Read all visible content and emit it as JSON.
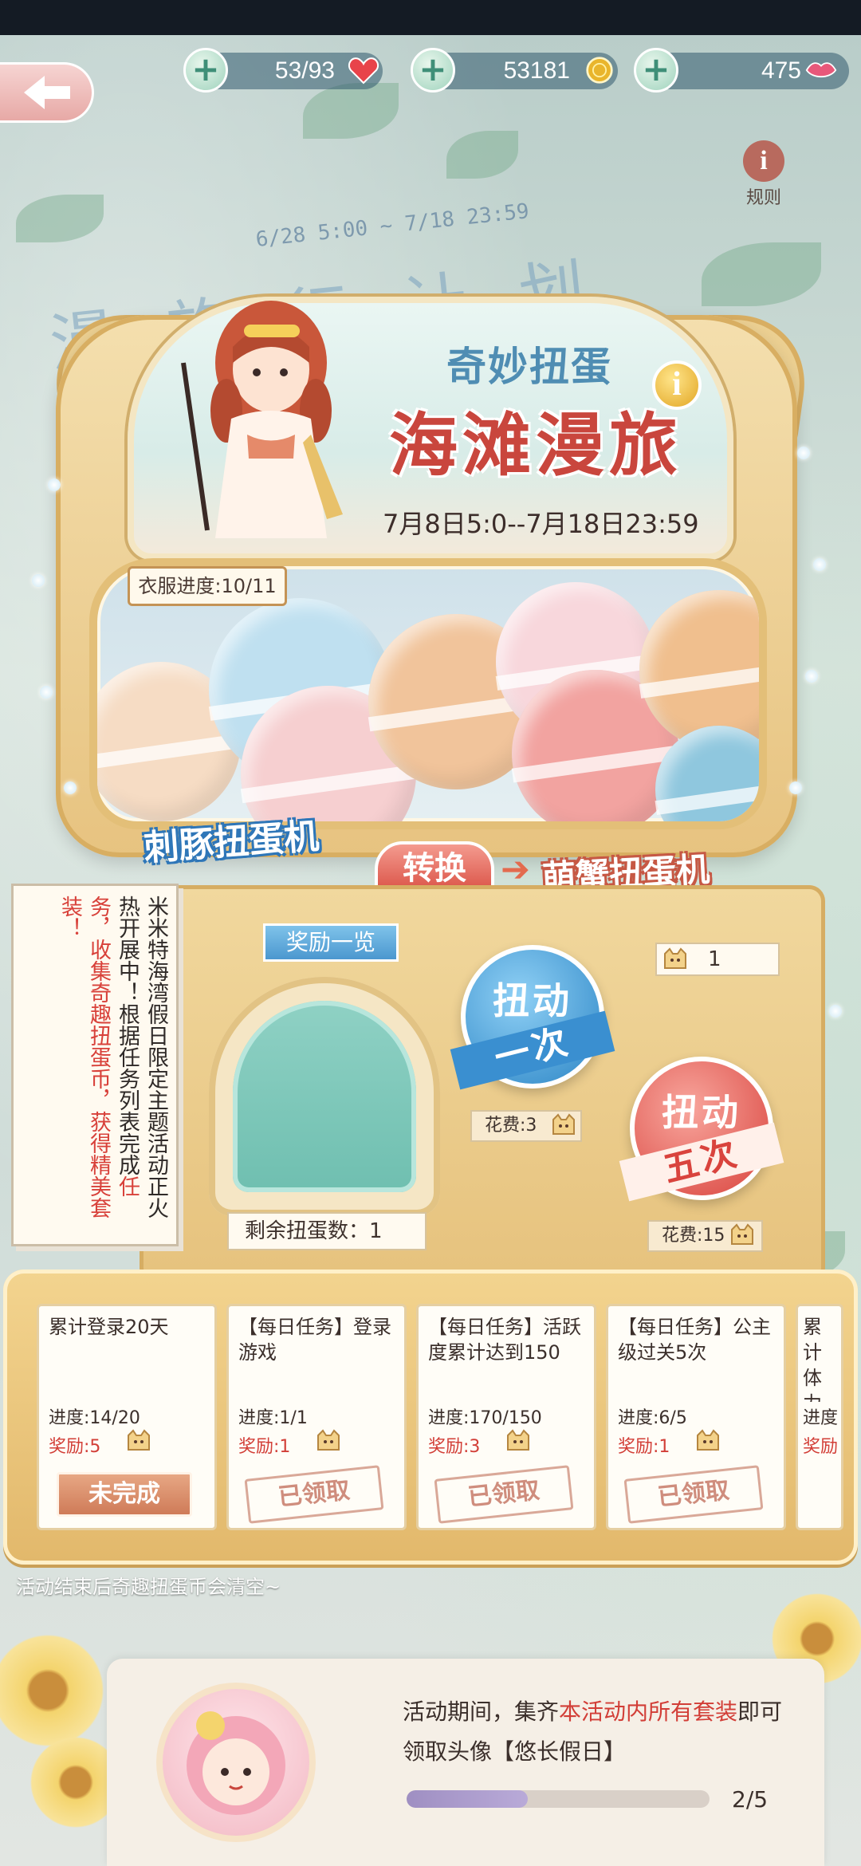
{
  "resources": {
    "stamina": "53/93",
    "gold": "53181",
    "diamonds": "475"
  },
  "rules_label": "规则",
  "event": {
    "dates_bg": "6/28  5:00 ~ 7/18  23:59",
    "bg_title": "漫 旅 行 计 划",
    "subtitle": "奇妙扭蛋",
    "title": "海滩漫旅",
    "date_range": "7月8日5:0--7月18日23:59",
    "outfit_progress": "衣服进度:10/11"
  },
  "machine": {
    "left_mode": "刺豚扭蛋机",
    "switch_label": "转换",
    "right_mode": "萌蟹扭蛋机",
    "reward_list_label": "奖励一览",
    "remaining_label": "剩余扭蛋数：1",
    "coin_count": "1",
    "spin_one": {
      "line1": "扭动",
      "line2": "一次",
      "cost": "花费:3"
    },
    "spin_five": {
      "line1": "扭动",
      "line2": "五次",
      "cost": "花费:15"
    }
  },
  "notice": {
    "text1": "米米特海湾假日限定主题活动正火热开展中！根据任务列表完成",
    "text2": "任务，收集奇趣扭蛋币，获得精美套装！"
  },
  "tasks": [
    {
      "title": "累计登录20天",
      "progress": "进度:14/20",
      "reward": "奖励:5",
      "status": "未完成",
      "state": "undone"
    },
    {
      "title": "【每日任务】登录游戏",
      "progress": "进度:1/1",
      "reward": "奖励:1",
      "status": "已领取",
      "state": "claimed"
    },
    {
      "title": "【每日任务】活跃度累计达到150",
      "progress": "进度:170/150",
      "reward": "奖励:3",
      "status": "已领取",
      "state": "claimed"
    },
    {
      "title": "【每日任务】公主级过关5次",
      "progress": "进度:6/5",
      "reward": "奖励:1",
      "status": "已领取",
      "state": "claimed"
    },
    {
      "title": "累计体力",
      "progress": "进度",
      "reward": "奖励",
      "status": "",
      "state": "partial"
    }
  ],
  "footer_note": "活动结束后奇趣扭蛋币会清空~",
  "collection": {
    "text_before": "活动期间，集齐",
    "text_highlight": "本活动内所有套装",
    "text_after": "即可",
    "text_line2": "领取头像【悠长假日】",
    "count": "2/5",
    "progress_fraction": 0.4
  },
  "colors": {
    "accent_red": "#d23e37",
    "accent_blue": "#2d86c6",
    "gold": "#e6c27d"
  }
}
